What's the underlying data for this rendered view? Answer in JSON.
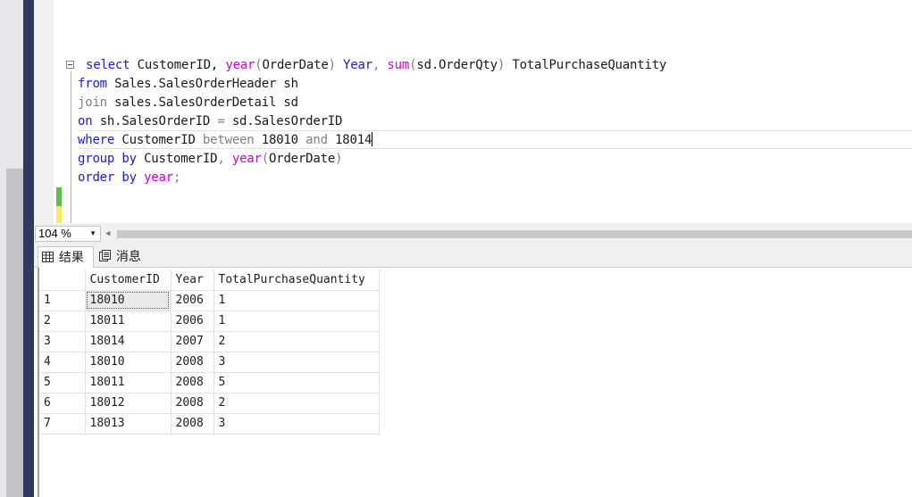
{
  "editor": {
    "line1": {
      "select": "select",
      "cols1": " CustomerID, ",
      "year": "year",
      "paren1": "(",
      "orderdate": "OrderDate",
      "paren2": ")",
      "alias_year": " Year",
      "comma": ",",
      "sum": " sum",
      "paren3": "(",
      "sdqty": "sd.OrderQty",
      "paren4": ")",
      "alias_total": " TotalPurchaseQuantity"
    },
    "line2": {
      "from": "from",
      "rest": " Sales.SalesOrderHeader sh"
    },
    "line3": {
      "join": "join",
      "rest": " sales.SalesOrderDetail sd"
    },
    "line4": {
      "on": "on",
      "left": " sh.SalesOrderID ",
      "eq": "=",
      "right": " sd.SalesOrderID"
    },
    "line5": {
      "where": "where",
      "col": " CustomerID ",
      "between": "between",
      "v1": " 18010 ",
      "and": "and",
      "v2": " 18014"
    },
    "line6": {
      "group": "group",
      "by": " by",
      "col": " CustomerID",
      "comma": ",",
      "year": " year",
      "paren1": "(",
      "orderdate": "OrderDate",
      "paren2": ")"
    },
    "line7": {
      "order": "order",
      "by": " by",
      "year": " year",
      "semi": ";"
    }
  },
  "zoom": {
    "value": "104 %"
  },
  "tabs": {
    "results": "结果",
    "messages": "消息"
  },
  "grid": {
    "headers": [
      "CustomerID",
      "Year",
      "TotalPurchaseQuantity"
    ],
    "rows": [
      {
        "num": "1",
        "customer": "18010",
        "year": "2006",
        "total": "1"
      },
      {
        "num": "2",
        "customer": "18011",
        "year": "2006",
        "total": "1"
      },
      {
        "num": "3",
        "customer": "18014",
        "year": "2007",
        "total": "2"
      },
      {
        "num": "4",
        "customer": "18010",
        "year": "2008",
        "total": "3"
      },
      {
        "num": "5",
        "customer": "18011",
        "year": "2008",
        "total": "5"
      },
      {
        "num": "6",
        "customer": "18012",
        "year": "2008",
        "total": "2"
      },
      {
        "num": "7",
        "customer": "18013",
        "year": "2008",
        "total": "3"
      }
    ]
  },
  "colors": {
    "keyword": "#1a1ad8",
    "function": "#d200d2",
    "operator": "#808080",
    "sidebar": "#2c3a5c"
  }
}
